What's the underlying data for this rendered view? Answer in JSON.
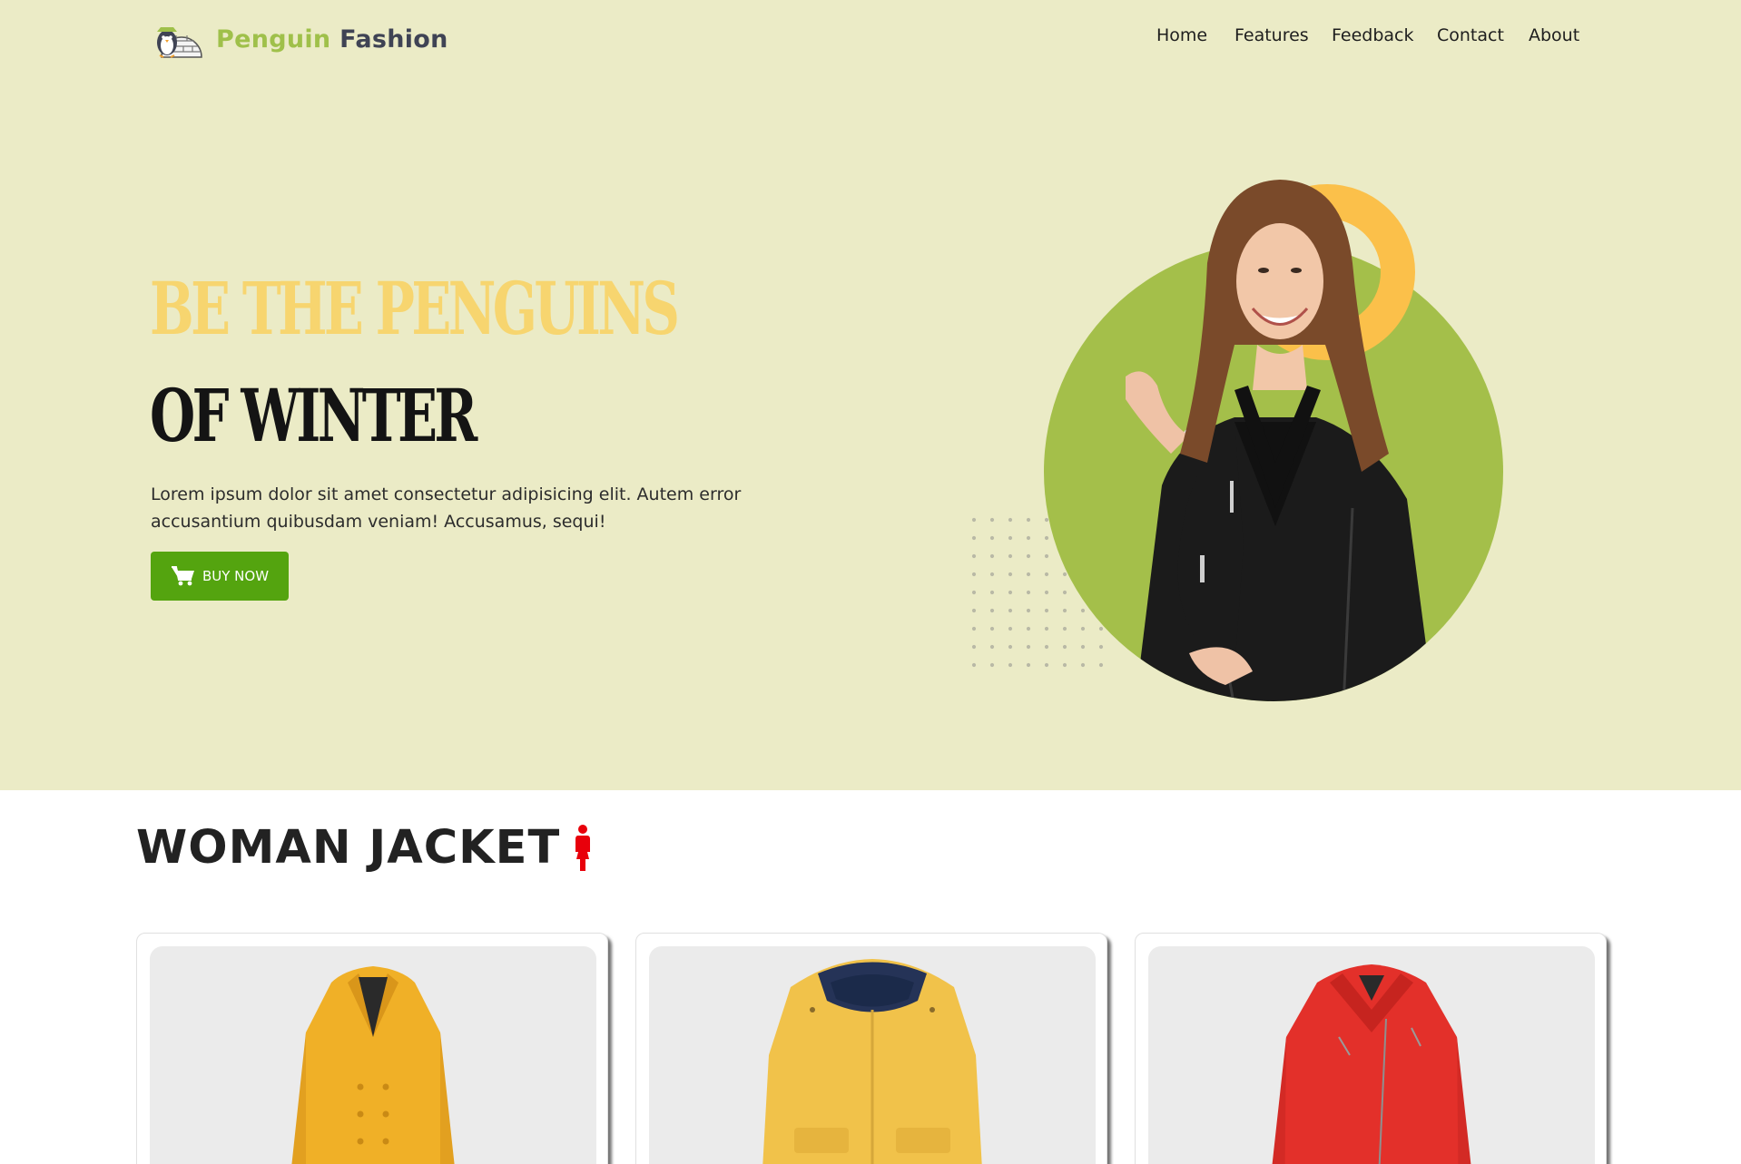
{
  "brand": {
    "word1": "Penguin",
    "word2": "Fashion"
  },
  "nav": {
    "items": [
      "Home",
      "Features",
      "Feedback",
      "Contact",
      "About"
    ]
  },
  "hero": {
    "headline_line1": "BE THE PENGUINS",
    "headline_line2": "OF WINTER",
    "description": "Lorem ipsum dolor sit amet consectetur adipisicing elit. Autem error accusantium quibusdam veniam! Accusamus, sequi!",
    "button_label": "BUY NOW",
    "button_icon": "shopping-cart-icon"
  },
  "section": {
    "title": "WOMAN JACKET",
    "icon": "woman-icon"
  },
  "products": [
    {
      "name": "yellow-trench-coat",
      "color": "#f0b027"
    },
    {
      "name": "yellow-hooded-raincoat",
      "color": "#f1c24a"
    },
    {
      "name": "red-leather-jacket",
      "color": "#e3302a"
    }
  ],
  "colors": {
    "hero_bg": "#ebebc6",
    "accent_green": "#54a40f",
    "logo_green": "#9fc04a",
    "headline_yellow": "#f7d56f",
    "circle_green": "#a4bf4a",
    "ring_orange": "#fbc04a"
  }
}
